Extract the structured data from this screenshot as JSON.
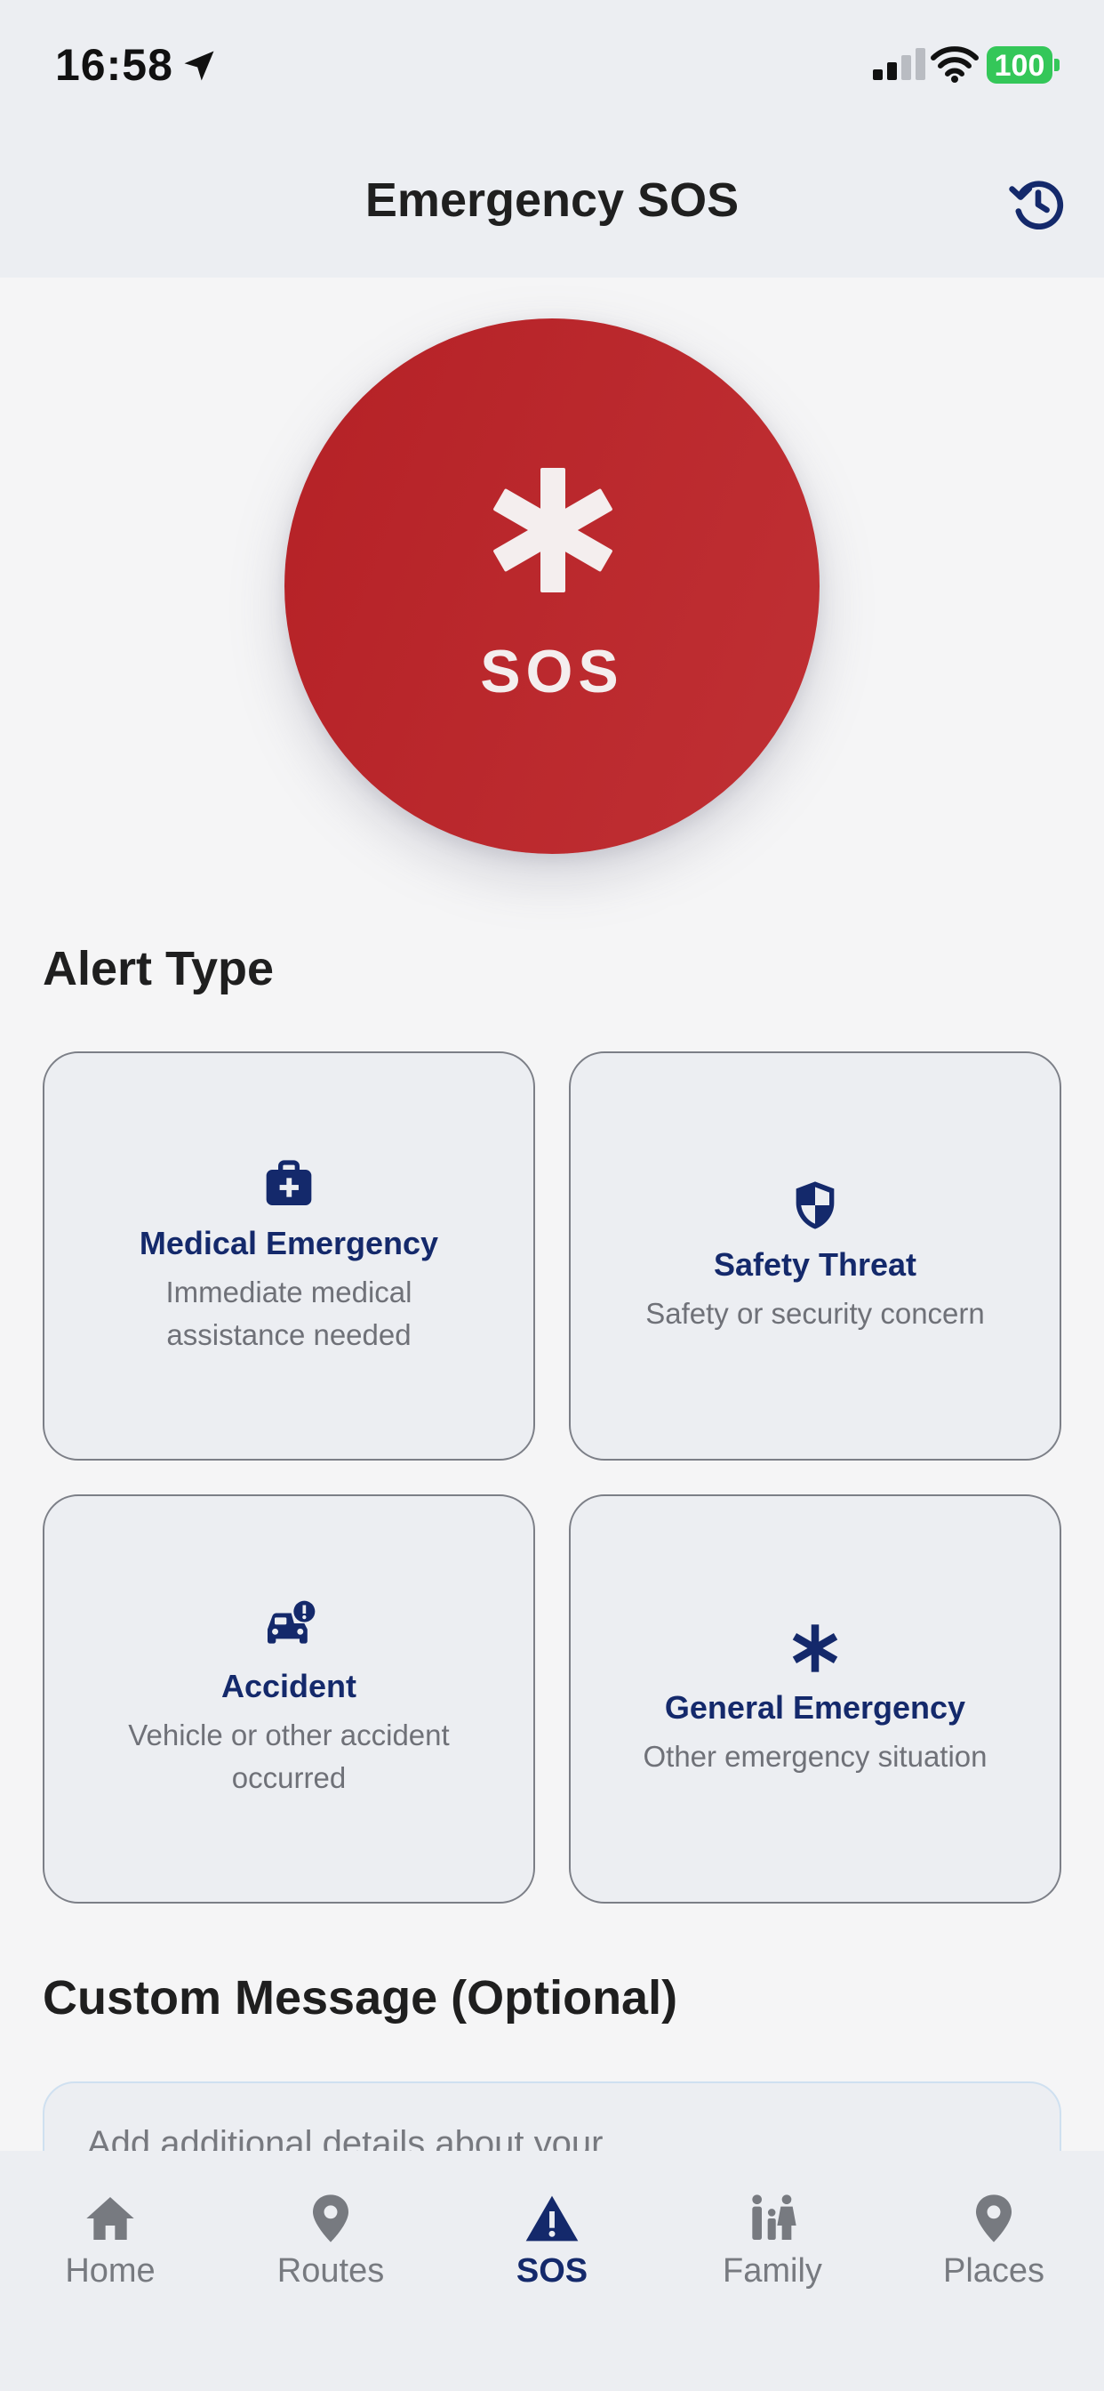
{
  "status_bar": {
    "time": "16:58",
    "battery": "100"
  },
  "header": {
    "title": "Emergency SOS"
  },
  "sos_button": {
    "label": "SOS"
  },
  "alert_type": {
    "title": "Alert Type",
    "cards": [
      {
        "title": "Medical Emergency",
        "description": "Immediate medical assistance needed",
        "icon": "medical-kit-icon"
      },
      {
        "title": "Safety Threat",
        "description": "Safety or security concern",
        "icon": "shield-icon"
      },
      {
        "title": "Accident",
        "description": "Vehicle or other accident occurred",
        "icon": "car-alert-icon"
      },
      {
        "title": "General Emergency",
        "description": "Other emergency situation",
        "icon": "asterisk-icon"
      }
    ]
  },
  "custom_message": {
    "title": "Custom Message (Optional)",
    "placeholder": "Add additional details about your"
  },
  "tab_bar": {
    "items": [
      {
        "label": "Home",
        "icon": "home-icon"
      },
      {
        "label": "Routes",
        "icon": "location-pin-icon"
      },
      {
        "label": "SOS",
        "icon": "warning-icon",
        "active": true
      },
      {
        "label": "Family",
        "icon": "family-icon"
      },
      {
        "label": "Places",
        "icon": "location-pin-icon"
      }
    ]
  },
  "colors": {
    "accent": "#14296b",
    "sos_red": "#b72428",
    "battery_green": "#34c759"
  }
}
